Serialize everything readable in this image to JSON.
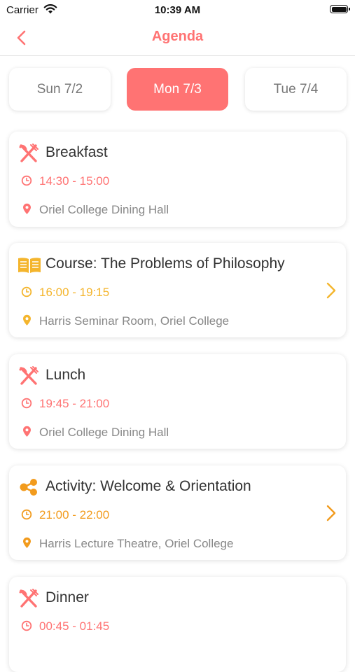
{
  "status_bar": {
    "carrier": "Carrier",
    "time": "10:39 AM"
  },
  "nav": {
    "title": "Agenda"
  },
  "colors": {
    "accent": "#ff7373",
    "course": "#f4b52d",
    "activity": "#f29b1d",
    "location": "#888888"
  },
  "day_tabs": [
    {
      "label": "Sun 7/2",
      "active": false
    },
    {
      "label": "Mon 7/3",
      "active": true
    },
    {
      "label": "Tue 7/4",
      "active": false
    }
  ],
  "events": [
    {
      "title": "Breakfast",
      "time": "14:30 - 15:00",
      "location": "Oriel College Dining Hall",
      "icon": "fork-knife-icon",
      "has_detail": false
    },
    {
      "title": "Course: The Problems of Philosophy",
      "time": "16:00 - 19:15",
      "location": "Harris Seminar Room, Oriel College",
      "icon": "book-icon",
      "has_detail": true
    },
    {
      "title": "Lunch",
      "time": "19:45 - 21:00",
      "location": "Oriel College Dining Hall",
      "icon": "fork-knife-icon",
      "has_detail": false
    },
    {
      "title": "Activity: Welcome & Orientation",
      "time": "21:00 - 22:00",
      "location": "Harris Lecture Theatre, Oriel College",
      "icon": "share-nodes-icon",
      "has_detail": true
    },
    {
      "title": "Dinner",
      "time": "00:45 - 01:45",
      "location": "",
      "icon": "fork-knife-icon",
      "has_detail": false
    }
  ]
}
